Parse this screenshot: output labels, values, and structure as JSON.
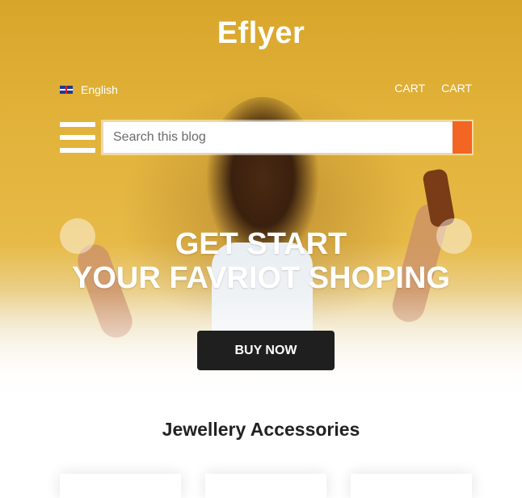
{
  "header": {
    "logo": "Eflyer",
    "language": "English",
    "links": [
      "CART",
      "CART"
    ]
  },
  "search": {
    "placeholder": "Search this blog",
    "value": ""
  },
  "hero": {
    "headline_line1": "GET START",
    "headline_line2": "YOUR FAVRIOT SHOPING",
    "cta_label": "BUY NOW"
  },
  "section": {
    "title": "Jewellery Accessories"
  },
  "colors": {
    "accent": "#f26522",
    "hero_bg": "#e3b43c",
    "button_dark": "#1f1f1f"
  }
}
